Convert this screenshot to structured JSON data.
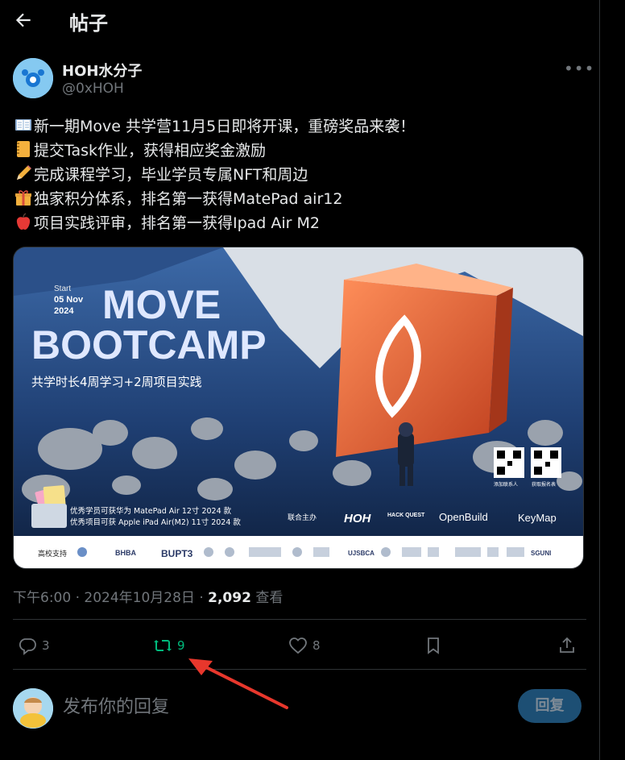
{
  "header": {
    "title": "帖子"
  },
  "author": {
    "name": "HOH水分子",
    "handle": "@0xHOH"
  },
  "post": {
    "lines": [
      {
        "icon": "book-icon",
        "text": "新一期Move 共学营11月5日即将开课，重磅奖品来袭！"
      },
      {
        "icon": "notebook-icon",
        "text": "提交Task作业，获得相应奖金激励"
      },
      {
        "icon": "pencil-icon",
        "text": "完成课程学习，毕业学员专属NFT和周边"
      },
      {
        "icon": "gift-icon",
        "text": "独家积分体系，排名第一获得MatePad air12"
      },
      {
        "icon": "apple-icon",
        "text": "项目实践评审，排名第一获得Ipad Air M2"
      }
    ]
  },
  "banner": {
    "start_label": "Start",
    "date_line1": "05 Nov",
    "date_line2": "2024",
    "title1": "MOVE",
    "title2": "BOOTCAMP",
    "subtitle": "共学时长4周学习+2周项目实践",
    "prize1": "优秀学员可获华为 MatePad Air 12寸 2024 款",
    "prize2": "优秀项目可获 Apple iPad Air(M2) 11寸 2024 款",
    "hosts_label": "联合主办",
    "host1": "HOH",
    "host2": "HACK QUEST",
    "host3": "OpenBuild",
    "host4": "KeyMap",
    "qr1_label": "添加联系人",
    "qr2_label": "获取报名表",
    "support_label": "高校支持",
    "support_logos": [
      "BHBA",
      "BUPT3",
      "UJSBCA",
      "SGUNI"
    ]
  },
  "meta": {
    "time": "下午6:00 · 2024年10月28日 · ",
    "views": "2,092",
    "views_label": " 查看"
  },
  "actions": {
    "replies": "3",
    "reposts": "9",
    "likes": "8"
  },
  "reply": {
    "placeholder": "发布你的回复",
    "button": "回复"
  },
  "colors": {
    "repost_active": "#00ba7c",
    "annotation_arrow": "#e8372c",
    "muted": "#71767b"
  }
}
